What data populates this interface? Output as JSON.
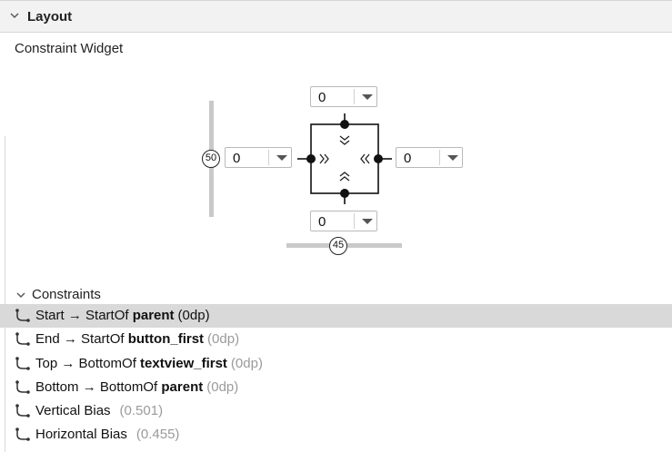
{
  "header": {
    "title": "Layout"
  },
  "widget": {
    "title": "Constraint Widget",
    "top_margin": "0",
    "left_margin": "0",
    "right_margin": "0",
    "bottom_margin": "0",
    "vertical_bias": "50",
    "horizontal_bias": "45"
  },
  "constraints": {
    "heading": "Constraints",
    "items": [
      {
        "side": "Start",
        "arrow": "→",
        "relation": "StartOf",
        "target": "parent",
        "value": "(0dp)",
        "selected": true
      },
      {
        "side": "End",
        "arrow": "→",
        "relation": "StartOf",
        "target": "button_first",
        "value": "(0dp)"
      },
      {
        "side": "Top",
        "arrow": "→",
        "relation": "BottomOf",
        "target": "textview_first",
        "value": "(0dp)"
      },
      {
        "side": "Bottom",
        "arrow": "→",
        "relation": "BottomOf",
        "target": "parent",
        "value": "(0dp)"
      },
      {
        "side": "Vertical Bias",
        "value": "(0.501)"
      },
      {
        "side": "Horizontal Bias",
        "value": "(0.455)"
      }
    ]
  }
}
